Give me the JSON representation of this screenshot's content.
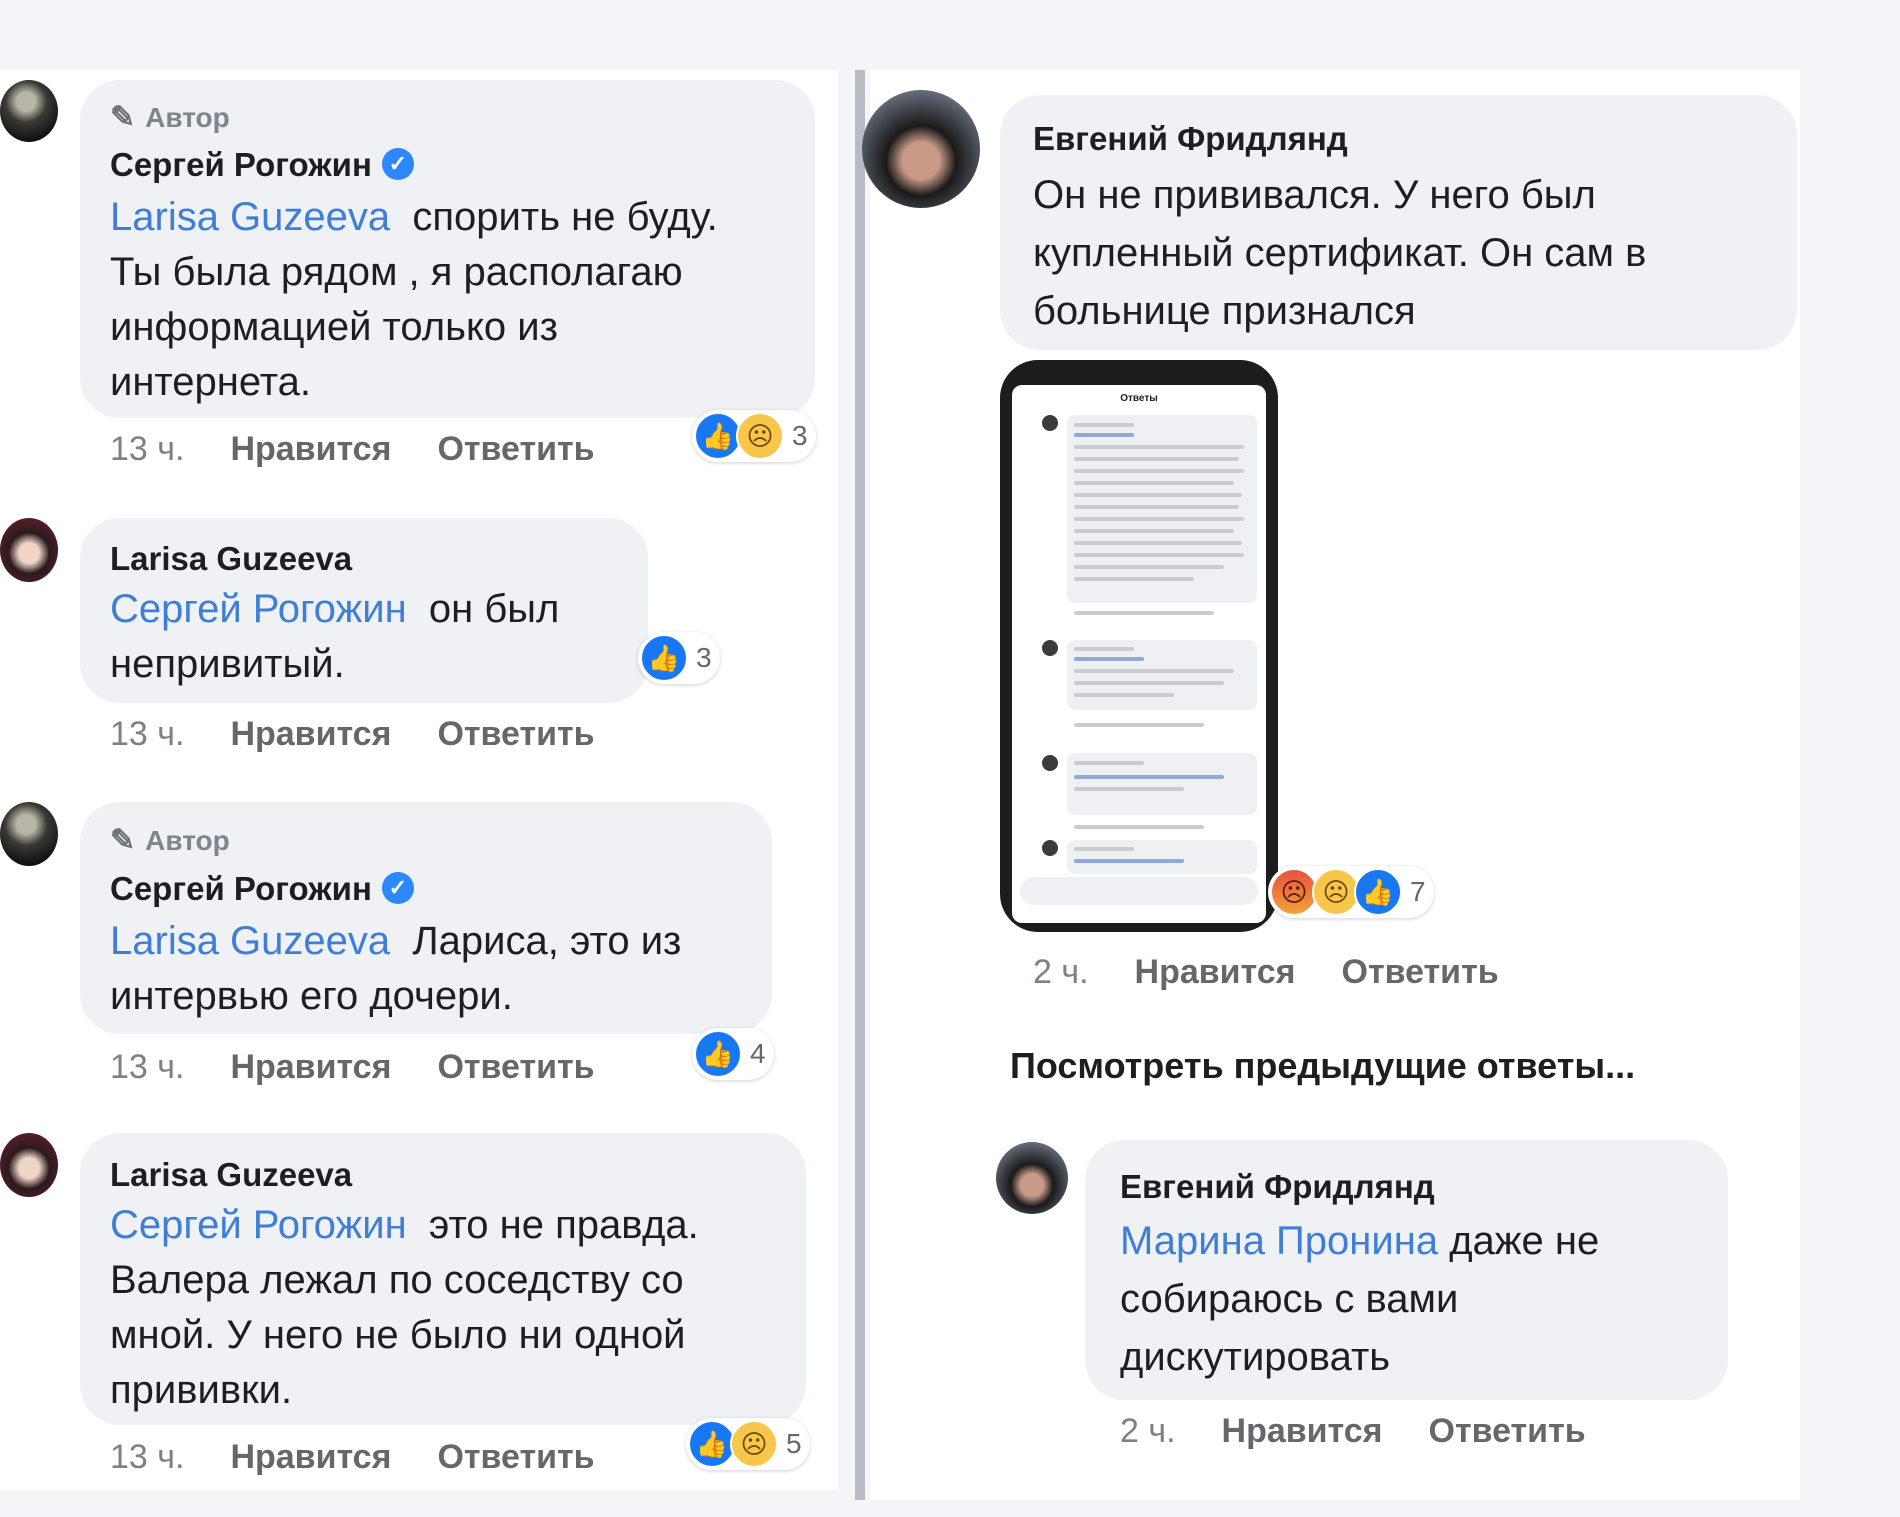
{
  "author_tag": "Автор",
  "comments": [
    {
      "name": "Сергей Рогожин",
      "mention": "Larisa Guzeeva",
      "line1": "спорить не буду.",
      "lines": [
        "Ты была рядом , я располагаю",
        "информацией только из",
        "интернета."
      ],
      "time": "13 ч.",
      "like": "Нравится",
      "reply": "Ответить",
      "reaction_count": "3"
    },
    {
      "name": "Larisa Guzeeva",
      "mention": "Сергей Рогожин",
      "line1": "он был",
      "lines": [
        "непривитый."
      ],
      "time": "13 ч.",
      "like": "Нравится",
      "reply": "Ответить",
      "reaction_count": "3"
    },
    {
      "name": "Сергей Рогожин",
      "mention": "Larisa Guzeeva",
      "line1": "Лариса, это из",
      "lines": [
        "интервью его дочери."
      ],
      "time": "13 ч.",
      "like": "Нравится",
      "reply": "Ответить",
      "reaction_count": "4"
    },
    {
      "name": "Larisa Guzeeva",
      "mention": "Сергей Рогожин",
      "line1": "это не правда.",
      "lines": [
        "Валера лежал по соседству со",
        "мной. У него не было ни одной",
        "прививки."
      ],
      "time": "13 ч.",
      "like": "Нравится",
      "reply": "Ответить",
      "reaction_count": "5"
    }
  ],
  "right_comments": [
    {
      "name": "Евгений Фридлянд",
      "lines": [
        "Он не прививался. У него был",
        "купленный сертификат. Он сам в",
        "больнице признался"
      ],
      "time": "2 ч.",
      "like": "Нравится",
      "reply": "Ответить",
      "reaction_count": "7",
      "screenshot_title": "Ответы"
    },
    {
      "name": "Евгений Фридлянд",
      "mention": "Марина Пронина",
      "line1": "даже не",
      "lines": [
        "собираюсь с вами",
        "дискутировать"
      ],
      "time": "2 ч.",
      "like": "Нравится",
      "reply": "Ответить"
    }
  ],
  "view_previous": "Посмотреть предыдущие ответы...",
  "icons": {
    "verified": "verified-badge-icon",
    "pen": "pen-icon",
    "like": "like-icon",
    "sad": "sad-icon",
    "angry": "angry-icon"
  },
  "colors": {
    "mention": "#3f7ed6",
    "bubble": "#eff1f4",
    "like": "#1877f2",
    "background": "#f3f5f9"
  }
}
